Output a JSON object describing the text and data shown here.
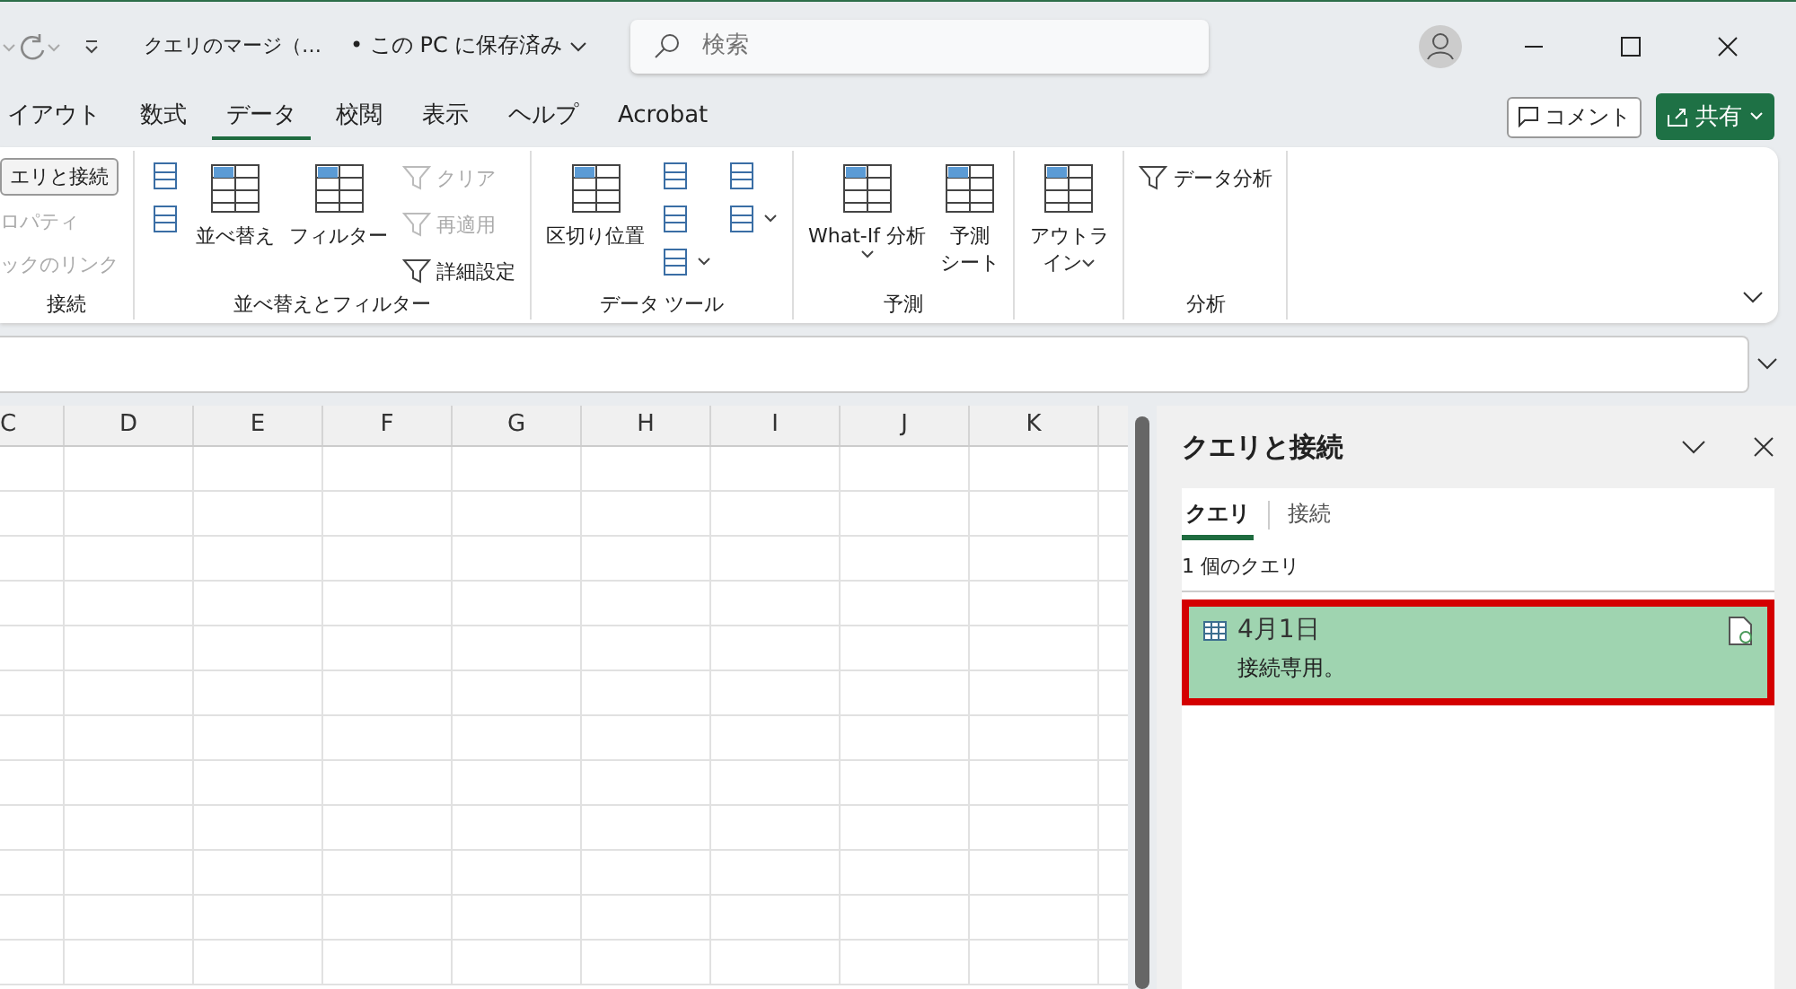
{
  "title_bar": {
    "file_name": "クエリのマージ（…",
    "save_status": "• この PC に保存済み",
    "search": {
      "placeholder": "検索"
    }
  },
  "ribbon_tabs": [
    {
      "label": "イアウト",
      "selected": false
    },
    {
      "label": "数式",
      "selected": false
    },
    {
      "label": "データ",
      "selected": true
    },
    {
      "label": "校閲",
      "selected": false
    },
    {
      "label": "表示",
      "selected": false
    },
    {
      "label": "ヘルプ",
      "selected": false
    },
    {
      "label": "Acrobat",
      "selected": false
    }
  ],
  "comment_button": "コメント",
  "share_button": "共有",
  "ribbon_groups": [
    {
      "label": "接続",
      "columns": [
        [
          {
            "kind": "outlined",
            "label": "エリと接続",
            "disabled": false
          },
          {
            "kind": "text",
            "label": "ロパティ",
            "disabled": true
          },
          {
            "kind": "text",
            "label": "ックのリンク",
            "disabled": true
          }
        ]
      ]
    },
    {
      "label": "並べ替えとフィルター",
      "columns": [
        [
          {
            "kind": "icon",
            "disabled": false
          },
          {
            "kind": "icon",
            "disabled": false
          }
        ],
        [
          {
            "kind": "large",
            "label": "並べ替え",
            "disabled": false
          }
        ],
        [
          {
            "kind": "large",
            "label": "フィルター",
            "disabled": false
          }
        ],
        [
          {
            "kind": "small",
            "label": "クリア",
            "disabled": true
          },
          {
            "kind": "small",
            "label": "再適用",
            "disabled": true
          },
          {
            "kind": "small",
            "label": "詳細設定",
            "disabled": false
          }
        ]
      ]
    },
    {
      "label": "データ ツール",
      "columns": [
        [
          {
            "kind": "large",
            "label": "区切り位置",
            "disabled": false
          }
        ],
        [
          {
            "kind": "icon",
            "disabled": false
          },
          {
            "kind": "icon",
            "disabled": false
          },
          {
            "kind": "icon",
            "caret": true,
            "disabled": false
          }
        ],
        [
          {
            "kind": "icon",
            "disabled": false
          },
          {
            "kind": "icon",
            "caret": true,
            "disabled": false
          }
        ]
      ]
    },
    {
      "label": "予測",
      "columns": [
        [
          {
            "kind": "large",
            "label": "What-If 分析",
            "caret": true,
            "disabled": false
          }
        ],
        [
          {
            "kind": "large",
            "lines": [
              "予測",
              "シート"
            ],
            "disabled": false
          }
        ]
      ]
    },
    {
      "columns": [
        [
          {
            "kind": "large",
            "lines": [
              "アウトラ",
              "イン"
            ],
            "caret": true,
            "disabled": false
          }
        ]
      ]
    },
    {
      "label": "分析",
      "columns": [
        [
          {
            "kind": "small",
            "label": "データ分析",
            "disabled": false
          }
        ]
      ]
    }
  ],
  "sheet": {
    "columns": [
      "C",
      "D",
      "E",
      "F",
      "G",
      "H",
      "I",
      "J",
      "K"
    ]
  },
  "side_pane": {
    "title": "クエリと接続",
    "tabs": [
      {
        "label": "クエリ",
        "selected": true
      },
      {
        "label": "接続",
        "selected": false
      }
    ],
    "count": "1 個のクエリ",
    "queries": [
      {
        "name": "4月1日",
        "status": "接続専用。",
        "selected": true
      }
    ]
  }
}
